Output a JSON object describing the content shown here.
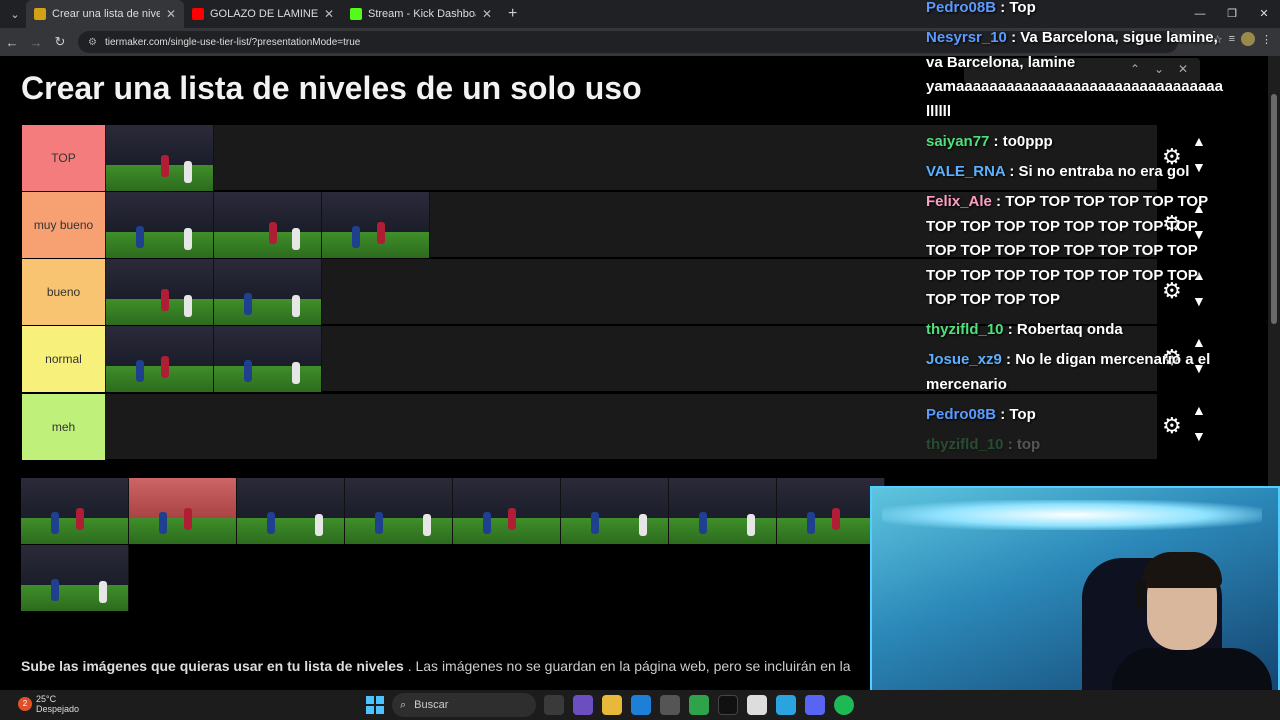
{
  "browser": {
    "tabs": [
      {
        "title": "Crear una lista de niveles de un",
        "active": true,
        "fav_color": "#d4a017"
      },
      {
        "title": "GOLAZO DE LAMINE YAMAL m",
        "active": false,
        "fav_color": "#ff0000"
      },
      {
        "title": "Stream - Kick Dashboard",
        "active": false,
        "fav_color": "#53fc18"
      }
    ],
    "url": "tiermaker.com/single-use-tier-list/?presentationMode=true"
  },
  "page": {
    "title": "Crear una lista de niveles de un solo uso",
    "tiers": [
      {
        "label": "TOP",
        "color": "#f47c7c",
        "items": 1
      },
      {
        "label": "muy bueno",
        "color": "#f7a172",
        "items": 3
      },
      {
        "label": "bueno",
        "color": "#f8c471",
        "items": 2
      },
      {
        "label": "normal",
        "color": "#f7f07a",
        "items": 2
      },
      {
        "label": "meh",
        "color": "#bff07a",
        "items": 0
      }
    ],
    "pool_count": 9,
    "desc_bold": "Sube las imágenes que quieras usar en tu lista de niveles",
    "desc_rest": " . Las imágenes no se guardan en la página web, pero se incluirán en la"
  },
  "chat": [
    {
      "user": "Pedro08B",
      "color": "#5b9bff",
      "text": " : Top"
    },
    {
      "user": "Nesyrsr_10",
      "color": "#5b9bff",
      "text": " : Va Barcelona, sigue lamine, va Barcelona, lamine yamaaaaaaaaaaaaaaaaaaaaaaaaaaaaaaaa llllll"
    },
    {
      "user": "saiyan77",
      "color": "#4ee07a",
      "text": " : to0ppp"
    },
    {
      "user": "VALE_RNA",
      "color": "#5bb0ff",
      "text": " : Si no entraba no era gol"
    },
    {
      "user": "Felix_Ale",
      "color": "#ff9ec4",
      "text": " : TOP TOP TOP TOP TOP TOP TOP TOP TOP TOP TOP TOP TOP TOP TOP TOP TOP TOP TOP TOP TOP TOP TOP TOP TOP TOP TOP TOP TOP TOP TOP TOP TOP TOP"
    },
    {
      "user": "thyzifld_10",
      "color": "#4ee07a",
      "text": " : Robertaq onda"
    },
    {
      "user": "Josue_xz9",
      "color": "#5bb0ff",
      "text": " : No le digan mercenario a el mercenario"
    },
    {
      "user": "Pedro08B",
      "color": "#5b9bff",
      "text": " : Top"
    },
    {
      "user": "thyzifld_10",
      "color": "#4ee07a",
      "text": " : top"
    }
  ],
  "taskbar": {
    "temp": "25°C",
    "weather": "Despejado",
    "search_placeholder": "Buscar"
  },
  "icons": {
    "gear": "gear-icon",
    "up": "chevron-up-icon",
    "down": "chevron-down-icon"
  }
}
